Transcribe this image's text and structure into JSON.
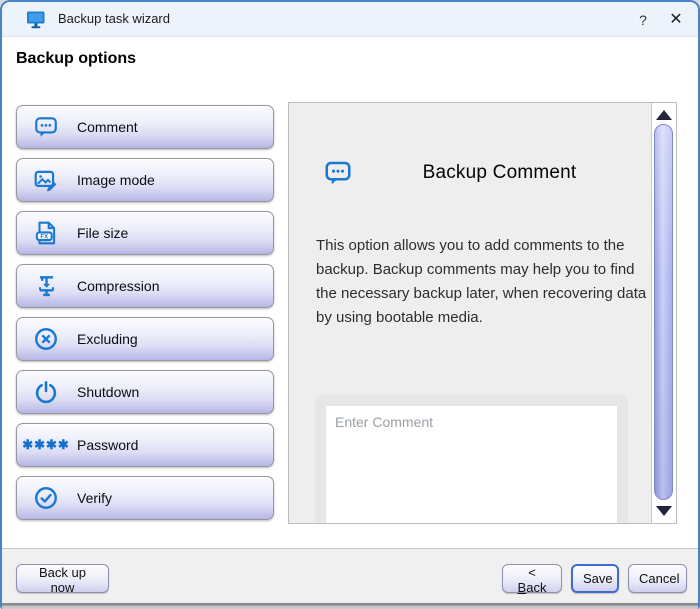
{
  "window": {
    "title": "Backup task wizard",
    "help_label": "?",
    "close_label": "✕"
  },
  "heading": "Backup options",
  "sidebar": {
    "items": [
      {
        "label": "Comment",
        "icon": "comment-icon"
      },
      {
        "label": "Image mode",
        "icon": "image-mode-icon"
      },
      {
        "label": "File size",
        "icon": "file-size-icon"
      },
      {
        "label": "Compression",
        "icon": "compression-icon"
      },
      {
        "label": "Excluding",
        "icon": "excluding-icon"
      },
      {
        "label": "Shutdown",
        "icon": "shutdown-icon"
      },
      {
        "label": "Password",
        "icon": "password-icon",
        "icon_glyph": "✱✱✱✱"
      },
      {
        "label": "Verify",
        "icon": "verify-icon"
      }
    ]
  },
  "panel": {
    "title": "Backup Comment",
    "description": "This option allows you to add comments to the backup. Backup comments may help you to find the necessary backup later, when recovering data by using bootable media.",
    "comment_input": {
      "value": "",
      "placeholder": "Enter Comment"
    }
  },
  "footer": {
    "backup_now_label": "Back up now",
    "back_prefix": "< ",
    "back_key": "B",
    "back_rest": "ack",
    "save_label": "Save",
    "cancel_label": "Cancel"
  },
  "colors": {
    "icon_blue": "#1878d2",
    "titlebar_bg": "#edf3fa",
    "window_border": "#4a82c8",
    "sidebar_button_bottom": "#b7b7e6",
    "panel_bg": "#efeeee",
    "scrollbar_thumb": "#c2c8f3",
    "save_border": "#3f6cd2"
  }
}
